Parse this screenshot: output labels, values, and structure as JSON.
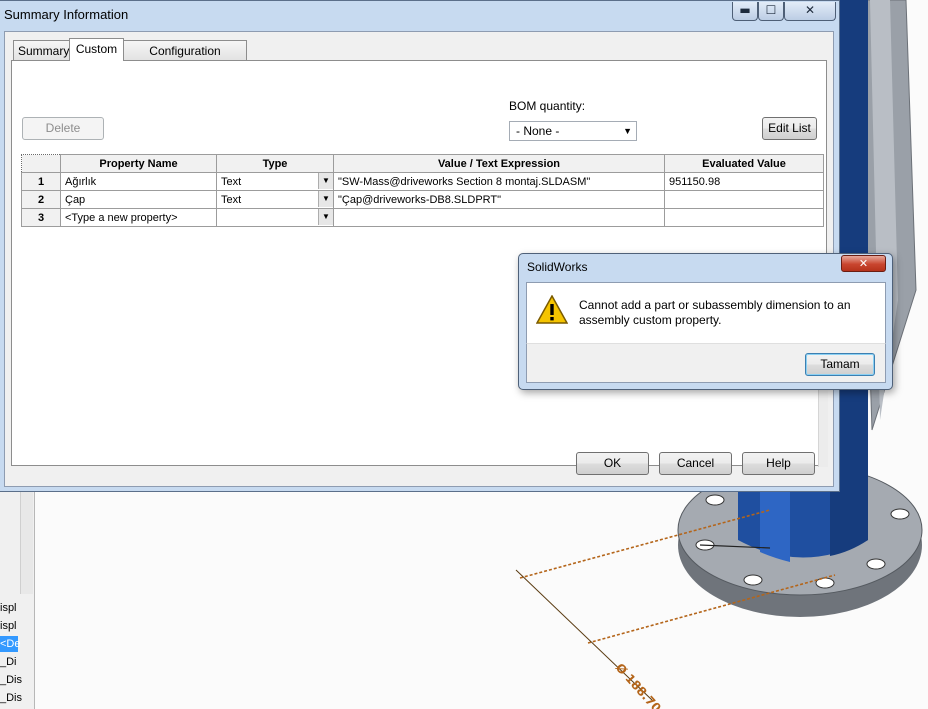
{
  "summary_window": {
    "title": "Summary Information",
    "caption_buttons": {
      "minimize": "▬",
      "maximize": "☐",
      "close": "✕"
    },
    "tabs": [
      {
        "label": "Summary",
        "active": false
      },
      {
        "label": "Custom",
        "active": true
      },
      {
        "label": "Configuration Specific",
        "active": false
      }
    ],
    "delete_label": "Delete",
    "bom_quantity_label": "BOM quantity:",
    "bom_quantity_value": "- None -",
    "edit_list_label": "Edit List",
    "grid": {
      "headers": [
        "Property Name",
        "Type",
        "Value / Text Expression",
        "Evaluated Value"
      ],
      "rows": [
        {
          "num": "1",
          "name": "Ağırlık",
          "type": "Text",
          "value": "\"SW-Mass@driveworks Section 8 montaj.SLDASM\"",
          "evaluated": "951150.98"
        },
        {
          "num": "2",
          "name": "Çap",
          "type": "Text",
          "value": "\"Çap@driveworks-DB8.SLDPRT\"",
          "evaluated": ""
        },
        {
          "num": "3",
          "name": "<Type a new property>",
          "type": "",
          "value": "",
          "evaluated": ""
        }
      ]
    },
    "footer": {
      "ok": "OK",
      "cancel": "Cancel",
      "help": "Help"
    }
  },
  "message_box": {
    "title": "SolidWorks",
    "close_label": "✕",
    "icon": "warning-icon",
    "message": "Cannot add a part or subassembly dimension to an assembly custom property.",
    "ok_label": "Tamam"
  },
  "background": {
    "tree_items": [
      "ispl",
      "ispl",
      "<De",
      "_Di",
      "_Dis",
      "_Dis"
    ],
    "dimension_label": "Ø 188.70"
  },
  "colors": {
    "title_bar": "#c7daf0",
    "pipe_blue": "#1f4fa0",
    "selection": "#3399ff",
    "dimension": "#b4651a"
  }
}
